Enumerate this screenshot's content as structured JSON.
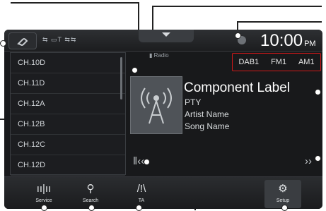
{
  "app": {
    "clock": "10:00",
    "clock_suffix": "PM"
  },
  "topbar": {
    "status": "⇆ ▭T ⇆⇆",
    "radio_label": "Radio"
  },
  "bands": [
    "DAB1",
    "FM1",
    "AM1"
  ],
  "channels": [
    "CH.10D",
    "CH.11D",
    "CH.12A",
    "CH.12B",
    "CH.12C",
    "CH.12D"
  ],
  "track": {
    "title": "Component Label",
    "pty": "PTY",
    "artist": "Artist Name",
    "song": "Song Name"
  },
  "bottom": {
    "service": "Service",
    "search": "Search",
    "ta": "TA",
    "setup": "Setup"
  }
}
